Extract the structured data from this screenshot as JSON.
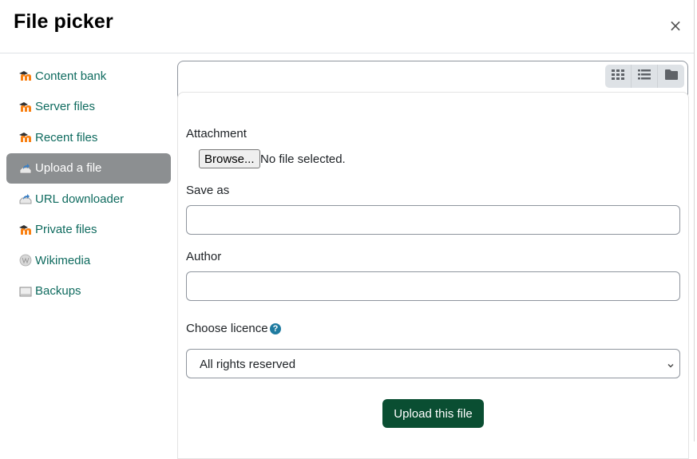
{
  "dialog": {
    "title": "File picker",
    "close_label": "×"
  },
  "sidebar": {
    "items": [
      {
        "label": "Content bank",
        "icon": "moodle-icon",
        "active": false
      },
      {
        "label": "Server files",
        "icon": "moodle-icon",
        "active": false
      },
      {
        "label": "Recent files",
        "icon": "moodle-icon",
        "active": false
      },
      {
        "label": "Upload a file",
        "icon": "upload-icon",
        "active": true
      },
      {
        "label": "URL downloader",
        "icon": "upload-icon",
        "active": false
      },
      {
        "label": "Private files",
        "icon": "moodle-icon",
        "active": false
      },
      {
        "label": "Wikimedia",
        "icon": "wikimedia-icon",
        "active": false
      },
      {
        "label": "Backups",
        "icon": "backup-icon",
        "active": false
      }
    ]
  },
  "toolbar": {
    "views": [
      "icons-view",
      "list-view",
      "folder-view"
    ]
  },
  "form": {
    "attachment_label": "Attachment",
    "browse_label": "Browse...",
    "no_file_text": "No file selected.",
    "save_as_label": "Save as",
    "save_as_value": "",
    "author_label": "Author",
    "author_value": "",
    "licence_label": "Choose licence",
    "help_glyph": "?",
    "licence_selected": "All rights reserved",
    "upload_label": "Upload this file"
  },
  "colors": {
    "accent_green": "#0a4e32",
    "link_teal": "#0f6b5f",
    "active_nav": "#8c8f91",
    "help_blue": "#1f7ba0"
  }
}
